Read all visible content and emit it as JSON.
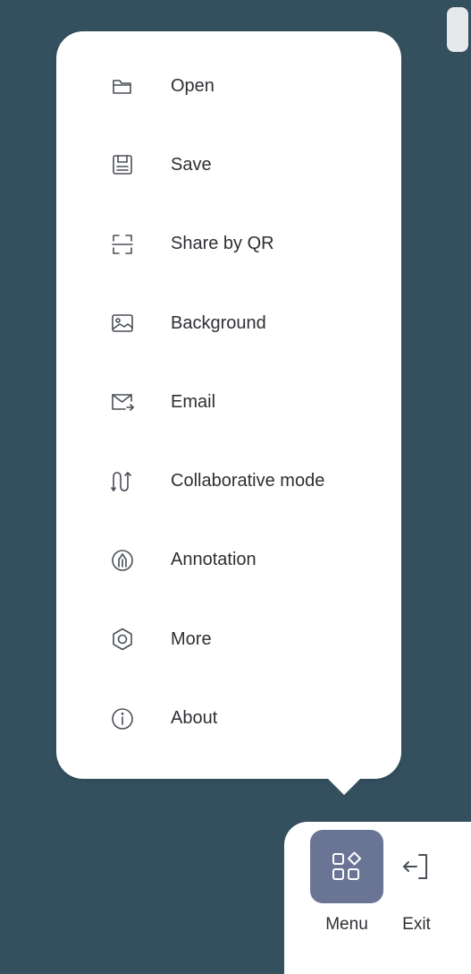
{
  "menu": {
    "items": [
      {
        "label": "Open",
        "icon": "folder-icon"
      },
      {
        "label": "Save",
        "icon": "save-icon"
      },
      {
        "label": "Share by QR",
        "icon": "qr-scan-icon"
      },
      {
        "label": "Background",
        "icon": "image-icon"
      },
      {
        "label": "Email",
        "icon": "email-icon"
      },
      {
        "label": "Collaborative mode",
        "icon": "collaborate-icon"
      },
      {
        "label": "Annotation",
        "icon": "annotation-icon"
      },
      {
        "label": "More",
        "icon": "gear-icon"
      },
      {
        "label": "About",
        "icon": "info-icon"
      }
    ]
  },
  "dock": {
    "menu_label": "Menu",
    "exit_label": "Exit"
  },
  "colors": {
    "background": "#34505f",
    "panel": "#ffffff",
    "active_button": "#6a7596",
    "icon": "#4a4f57",
    "text": "#2c2f33"
  }
}
